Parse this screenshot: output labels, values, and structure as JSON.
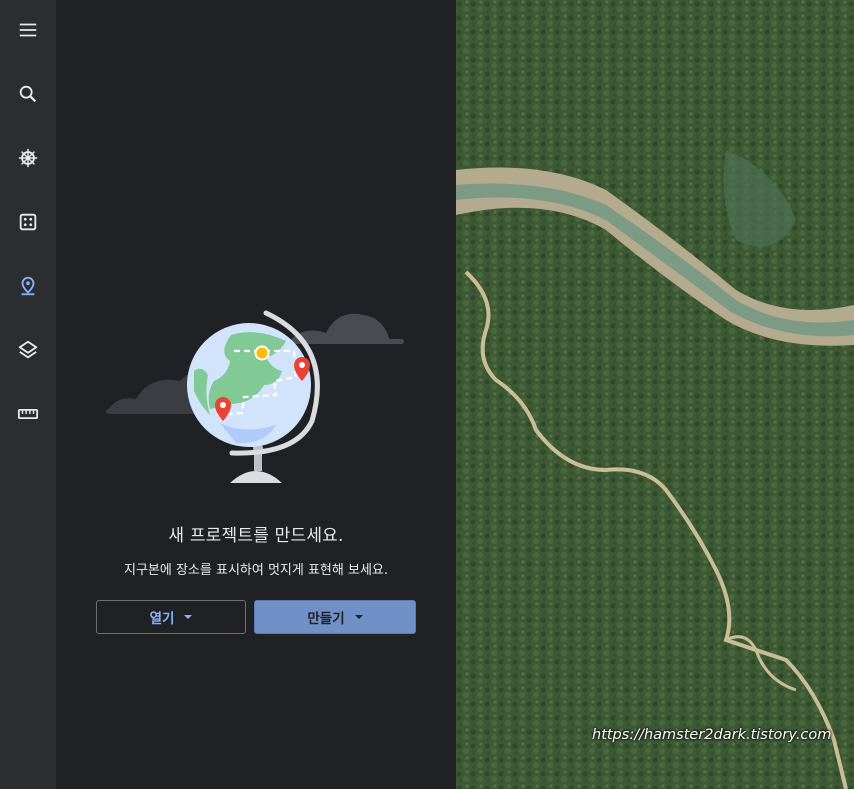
{
  "rail": {
    "items": [
      {
        "icon": "menu-icon"
      },
      {
        "icon": "search-icon"
      },
      {
        "icon": "ship-wheel-icon"
      },
      {
        "icon": "dice-icon"
      },
      {
        "icon": "map-pin-icon",
        "active": true
      },
      {
        "icon": "layers-icon"
      },
      {
        "icon": "ruler-icon"
      }
    ]
  },
  "panel": {
    "title": "새 프로젝트를 만드세요.",
    "subtitle": "지구본에 장소를 표시하여 멋지게 표현해 보세요.",
    "open_label": "열기",
    "create_label": "만들기"
  },
  "map": {
    "watermark": "https://hamster2dark.tistory.com"
  },
  "colors": {
    "accent": "#8ab4f8",
    "create_button": "#7090c8",
    "rail_bg": "#2c2d30",
    "panel_bg": "#202124"
  }
}
